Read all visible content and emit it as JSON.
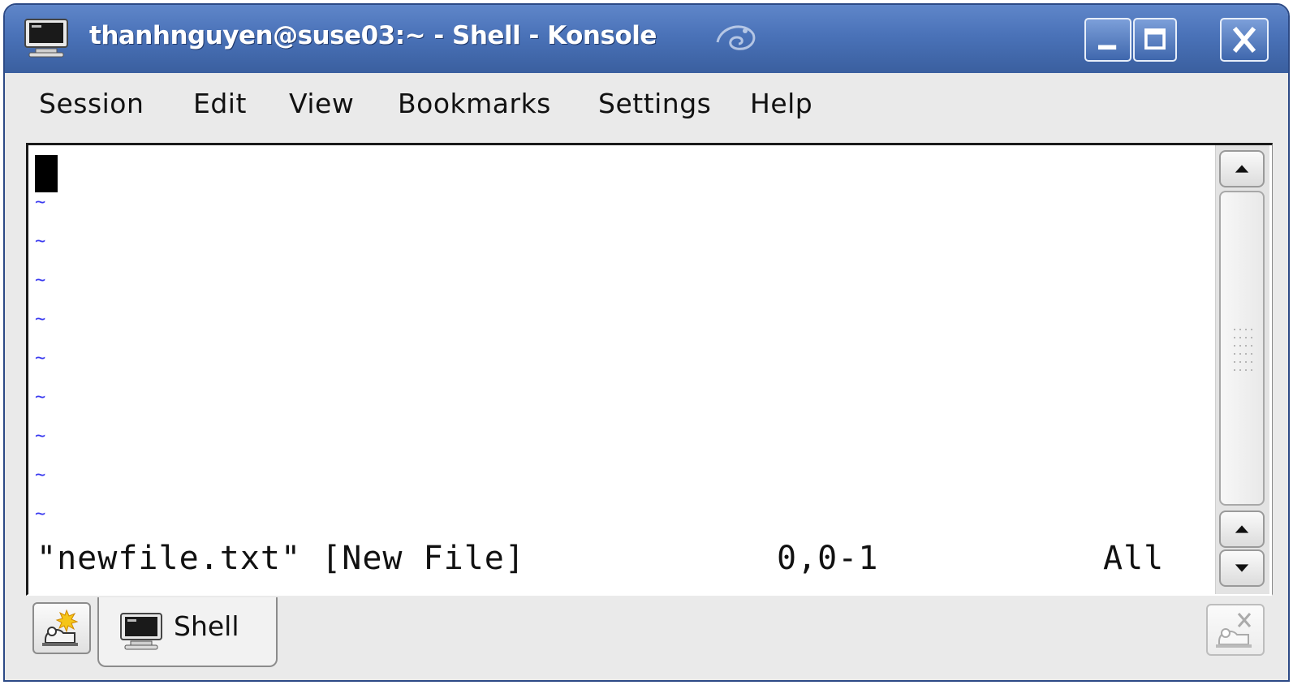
{
  "window": {
    "title": "thanhnguyen@suse03:~ - Shell - Konsole",
    "app_icon": "terminal-icon",
    "brand_icon": "suse-chameleon-icon",
    "controls": [
      "minimize-icon",
      "maximize-icon",
      "close-icon"
    ],
    "accent": "#4a72b8"
  },
  "menubar": {
    "items": [
      "Session",
      "Edit",
      "View",
      "Bookmarks",
      "Settings",
      "Help"
    ]
  },
  "terminal": {
    "empty_line_marker": "~",
    "status": {
      "filename": "\"newfile.txt\" [New File]",
      "position": "0,0-1",
      "scroll": "All"
    },
    "tilde_color": "#3a3af0"
  },
  "tabs": {
    "new_tab_icon": "new-session-icon",
    "items": [
      {
        "label": "Shell",
        "icon": "terminal-icon"
      }
    ],
    "close_tab_icon": "close-session-icon"
  }
}
